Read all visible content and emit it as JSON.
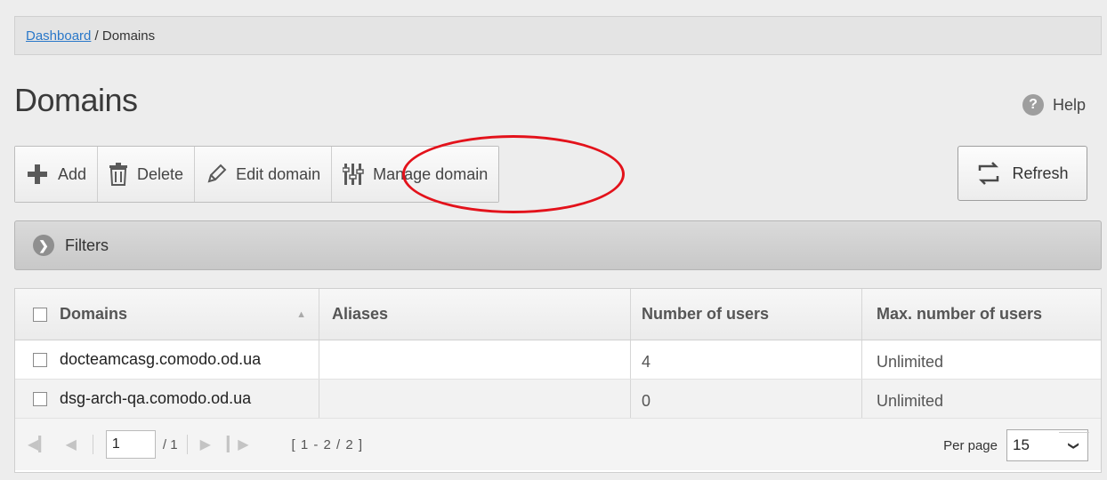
{
  "breadcrumb": {
    "dashboard": "Dashboard",
    "separator": " / ",
    "current": "Domains"
  },
  "title": "Domains",
  "help": {
    "label": "Help",
    "icon": "help-icon"
  },
  "toolbar": {
    "add": "Add",
    "delete": "Delete",
    "edit": "Edit domain",
    "manage": "Manage domain"
  },
  "refresh": "Refresh",
  "filters": "Filters",
  "table": {
    "headers": [
      "Domains",
      "Aliases",
      "Number of users",
      "Max. number of users"
    ],
    "rows": [
      {
        "domain": "docteamcasg.comodo.od.ua",
        "aliases": "",
        "users": "4",
        "max": "Unlimited"
      },
      {
        "domain": "dsg-arch-qa.comodo.od.ua",
        "aliases": "",
        "users": "0",
        "max": "Unlimited"
      }
    ]
  },
  "pager": {
    "page": "1",
    "total": "/ 1",
    "range": "[ 1 - 2 / 2 ]",
    "per_page_label": "Per page",
    "per_page": "15"
  },
  "colors": {
    "accent_link": "#2a78c9",
    "annotation": "#e3121b"
  }
}
